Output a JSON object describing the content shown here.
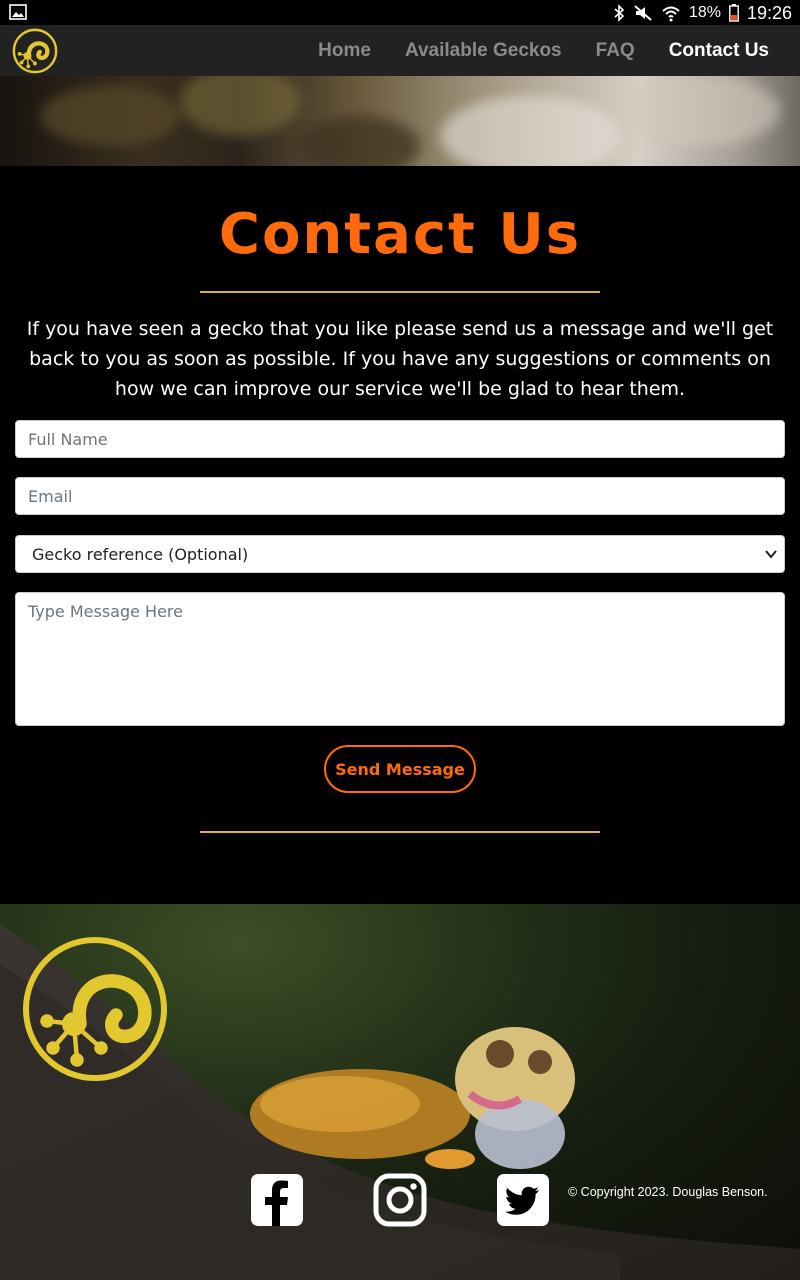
{
  "status_bar": {
    "battery_percent": "18%",
    "time": "19:26"
  },
  "nav": {
    "items": [
      {
        "label": "Home",
        "active": false
      },
      {
        "label": "Available Geckos",
        "active": false
      },
      {
        "label": "FAQ",
        "active": false
      },
      {
        "label": "Contact Us",
        "active": true
      }
    ]
  },
  "main": {
    "title": "Contact Us",
    "intro": "If you have seen a gecko that you like please send us a message and we'll get back to you as soon as possible. If you have any suggestions or comments on how we can improve our service we'll be glad to hear them.",
    "form": {
      "full_name_placeholder": "Full Name",
      "email_placeholder": "Email",
      "gecko_reference_selected": "Gecko reference (Optional)",
      "message_placeholder": "Type Message Here",
      "send_label": "Send Message"
    }
  },
  "footer": {
    "social": [
      "facebook-icon",
      "instagram-icon",
      "twitter-icon"
    ],
    "copyright": "© Copyright 2023. Douglas Benson."
  },
  "colors": {
    "accent_orange": "#ff6a0d",
    "accent_gold": "#d8b52a",
    "nav_bg": "#222222"
  }
}
